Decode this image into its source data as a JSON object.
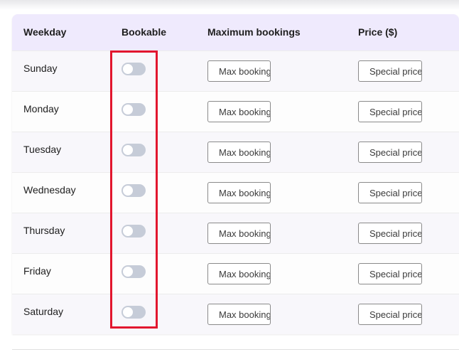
{
  "table": {
    "headers": {
      "weekday": "Weekday",
      "bookable": "Bookable",
      "max_bookings": "Maximum bookings",
      "price": "Price ($)"
    },
    "rows": [
      {
        "day": "Sunday",
        "bookable": false,
        "max_placeholder": "Max bookings",
        "price_placeholder": "Special price"
      },
      {
        "day": "Monday",
        "bookable": false,
        "max_placeholder": "Max bookings",
        "price_placeholder": "Special price"
      },
      {
        "day": "Tuesday",
        "bookable": false,
        "max_placeholder": "Max bookings",
        "price_placeholder": "Special price"
      },
      {
        "day": "Wednesday",
        "bookable": false,
        "max_placeholder": "Max bookings",
        "price_placeholder": "Special price"
      },
      {
        "day": "Thursday",
        "bookable": false,
        "max_placeholder": "Max bookings",
        "price_placeholder": "Special price"
      },
      {
        "day": "Friday",
        "bookable": false,
        "max_placeholder": "Max bookings",
        "price_placeholder": "Special price"
      },
      {
        "day": "Saturday",
        "bookable": false,
        "max_placeholder": "Max bookings",
        "price_placeholder": "Special price"
      }
    ]
  },
  "colors": {
    "header_bg": "#efeafd",
    "toggle_off": "#c6ccd8",
    "highlight": "#e2162e"
  }
}
